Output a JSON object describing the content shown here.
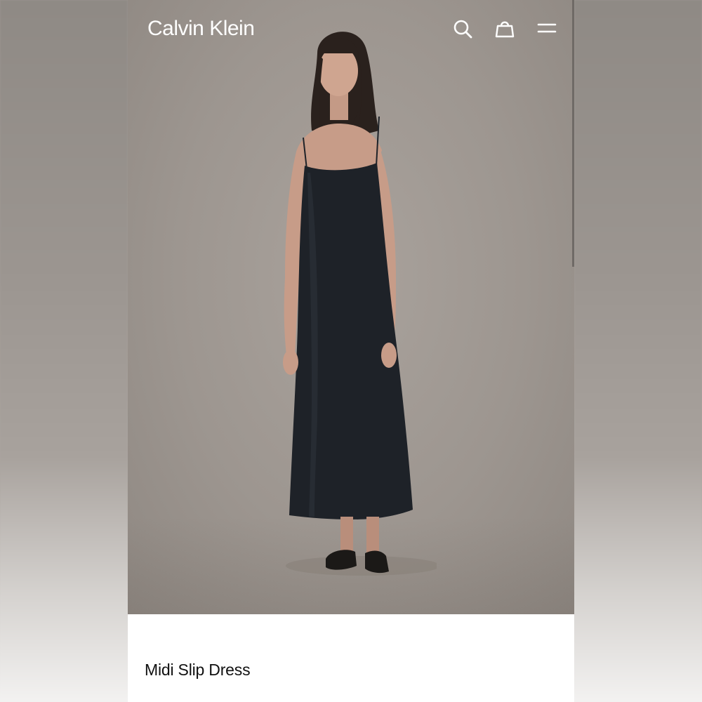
{
  "header": {
    "logo": "Calvin Klein",
    "icons": [
      "search-icon",
      "bag-icon",
      "menu-icon"
    ]
  },
  "hero": {
    "image_subject": "product-photo",
    "dress_color": "#1e2228",
    "background_color": "#9f9892"
  },
  "product": {
    "name": "Midi Slip Dress"
  },
  "colors": {
    "header_text": "#ffffff",
    "product_text": "#111111"
  }
}
